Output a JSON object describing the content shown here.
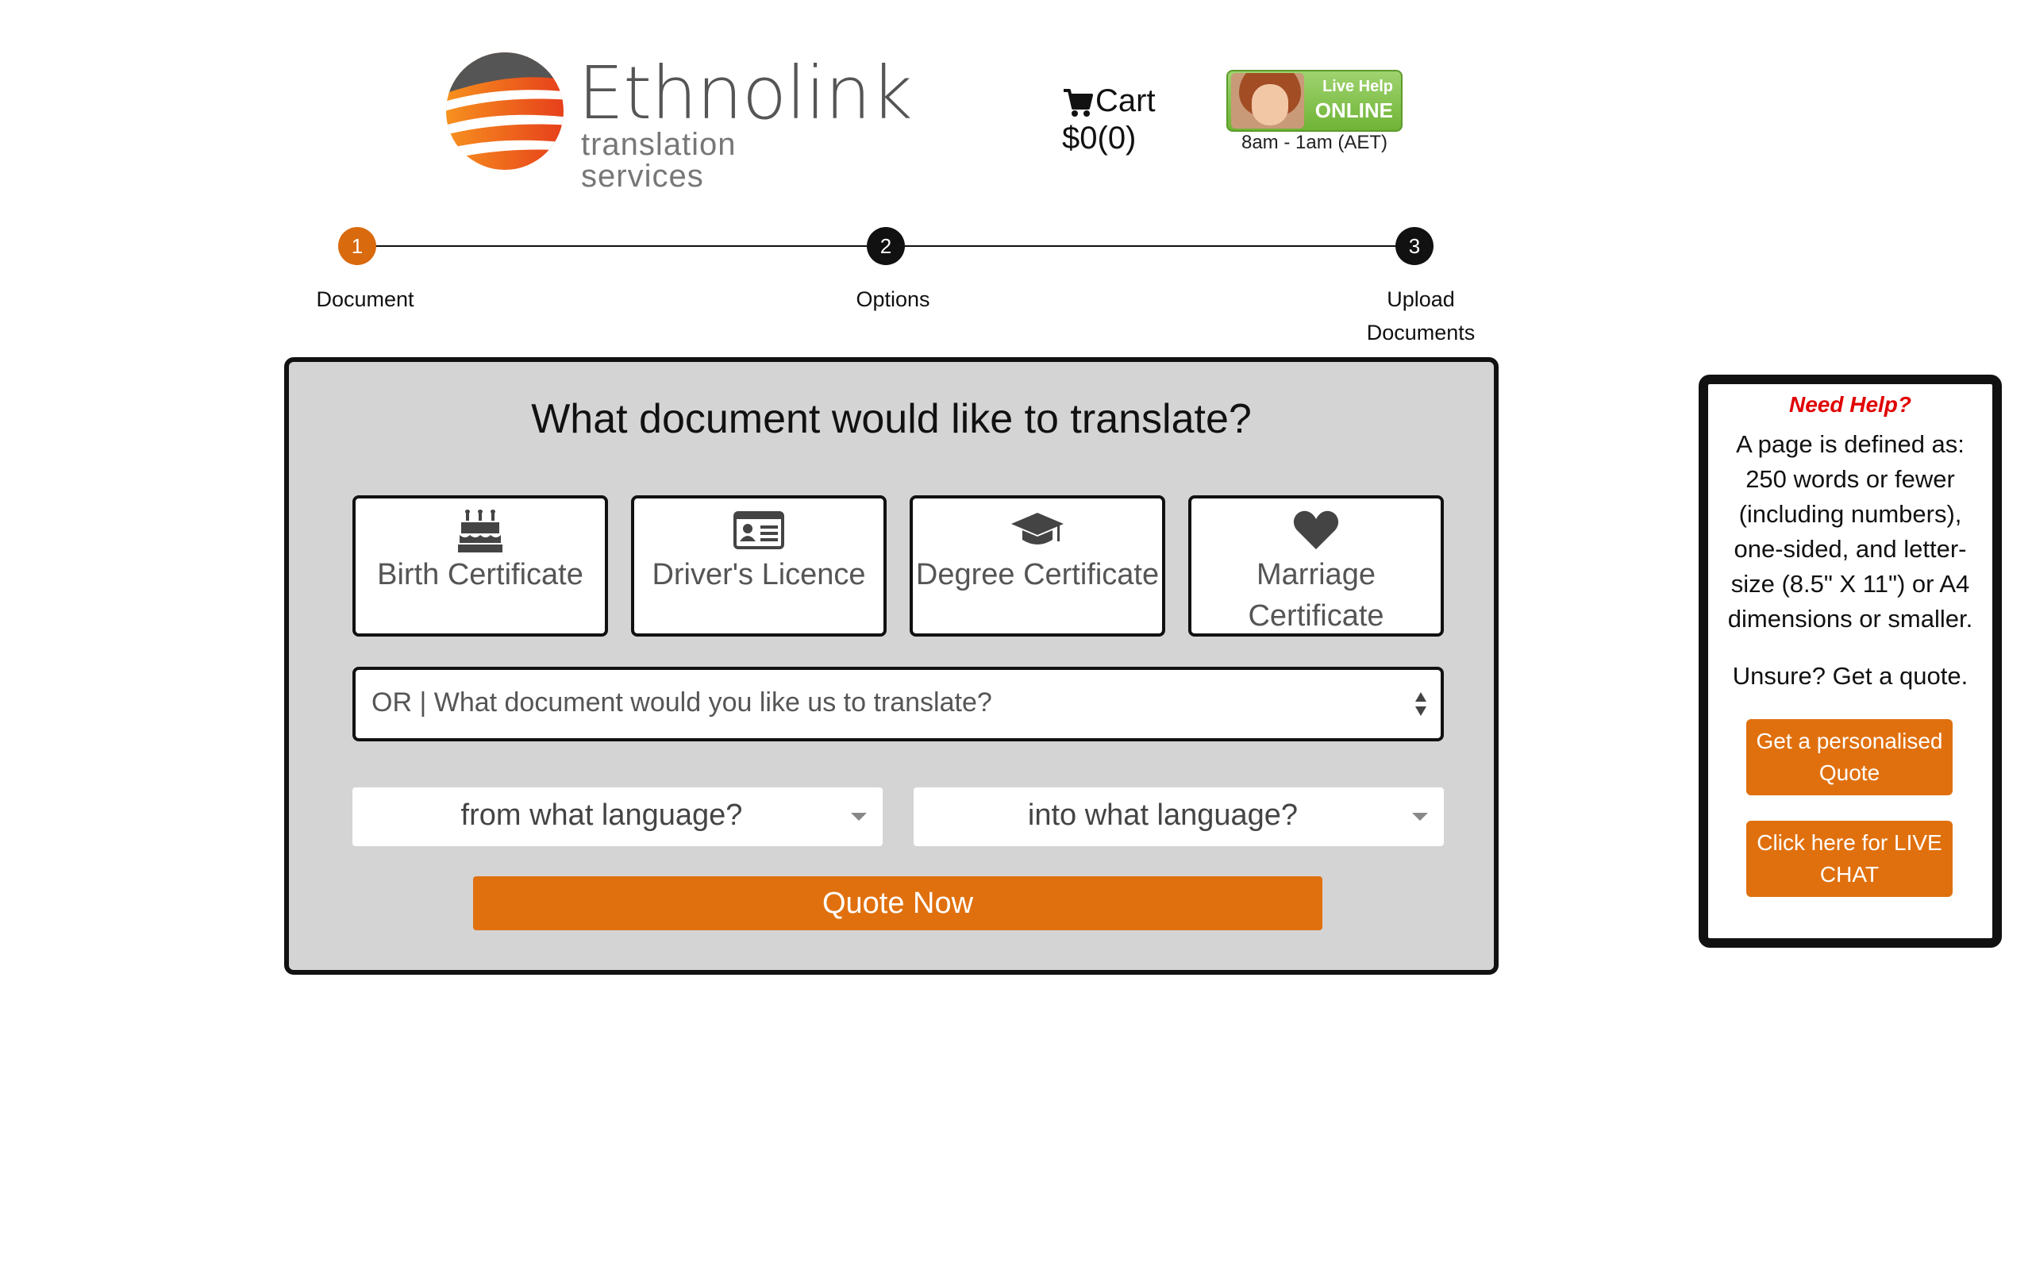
{
  "brand": {
    "name": "Ethnolink",
    "tagline": "translation services",
    "colors": {
      "accent": "#e0700e",
      "step_active": "#d96a0e",
      "logo_gray": "#555555",
      "help_title": "#e00000"
    }
  },
  "cart": {
    "label": "Cart",
    "total": "$0(0)",
    "icon": "cart-icon"
  },
  "live_help": {
    "line1": "Live Help",
    "line2": "ONLINE",
    "hours": "8am - 1am (AET)"
  },
  "stepper": {
    "steps": [
      {
        "number": "1",
        "label": "Document",
        "active": true
      },
      {
        "number": "2",
        "label": "Options",
        "active": false
      },
      {
        "number": "3",
        "label": "Upload Documents",
        "active": false
      }
    ]
  },
  "main": {
    "title": "What document would like to translate?",
    "cards": [
      {
        "label": "Birth Certificate",
        "icon": "birthday-cake-icon"
      },
      {
        "label": "Driver's Licence",
        "icon": "id-card-icon"
      },
      {
        "label": "Degree Certificate",
        "icon": "graduation-cap-icon"
      },
      {
        "label": "Marriage Certificate",
        "icon": "heart-icon"
      }
    ],
    "doc_select": {
      "value": "OR |  What document would you like us to translate?"
    },
    "from_language": {
      "placeholder": "from what language?"
    },
    "into_language": {
      "placeholder": "into what language?"
    },
    "quote_button": "Quote Now"
  },
  "help": {
    "title": "Need Help?",
    "text": "A page is defined as: 250 words or fewer (including numbers), one-sided, and letter-size (8.5\" X 11\") or A4 dimensions or smaller.",
    "unsure": "Unsure? Get a quote.",
    "quote_button": "Get a personalised Quote",
    "chat_button": "Click here for LIVE CHAT"
  }
}
